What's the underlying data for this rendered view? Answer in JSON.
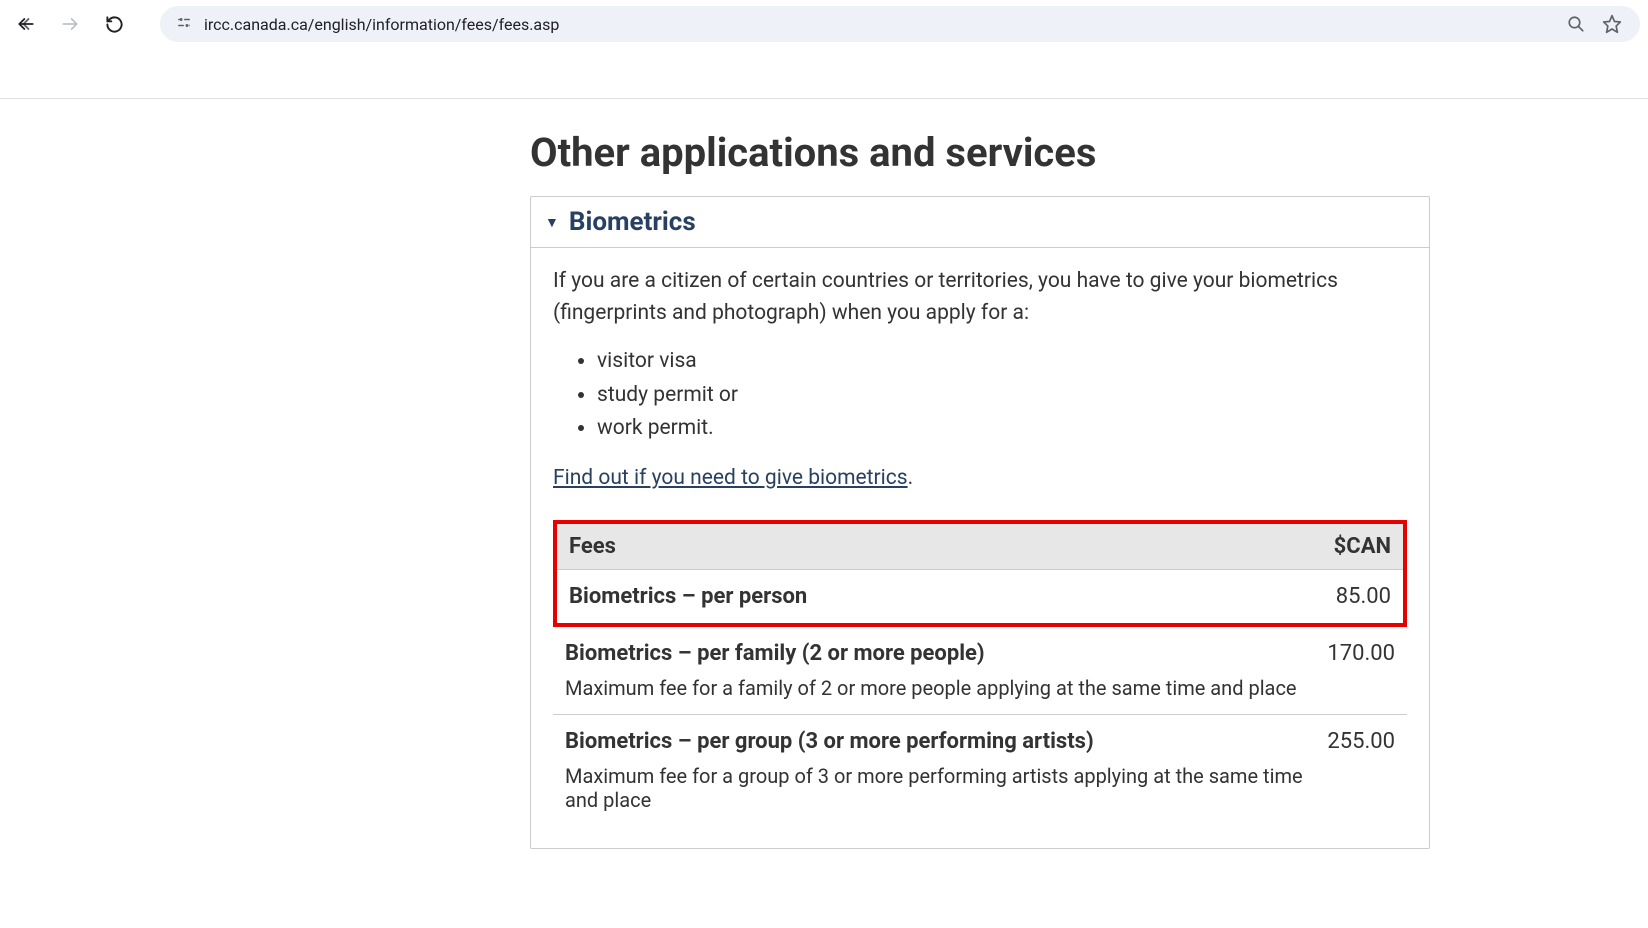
{
  "browser": {
    "url": "ircc.canada.ca/english/information/fees/fees.asp"
  },
  "page": {
    "heading": "Other applications and services",
    "accordion": {
      "title": "Biometrics",
      "intro": "If you are a citizen of certain countries or territories, you have to give your biometrics (fingerprints and photograph) when you apply for a:",
      "bullets": [
        "visitor visa",
        "study permit or",
        "work permit."
      ],
      "link_text": "Find out if you need to give biometrics",
      "link_suffix": "."
    },
    "fees": {
      "header_left": "Fees",
      "header_right": "$CAN",
      "rows": [
        {
          "name": "Biometrics – per person",
          "price": "85.00",
          "desc": ""
        },
        {
          "name": "Biometrics – per family (2 or more people)",
          "price": "170.00",
          "desc": "Maximum fee for a family of 2 or more people applying at the same time and place"
        },
        {
          "name": "Biometrics – per group (3 or more performing artists)",
          "price": "255.00",
          "desc": "Maximum fee for a group of 3 or more performing artists applying at the same time and place"
        }
      ]
    }
  }
}
